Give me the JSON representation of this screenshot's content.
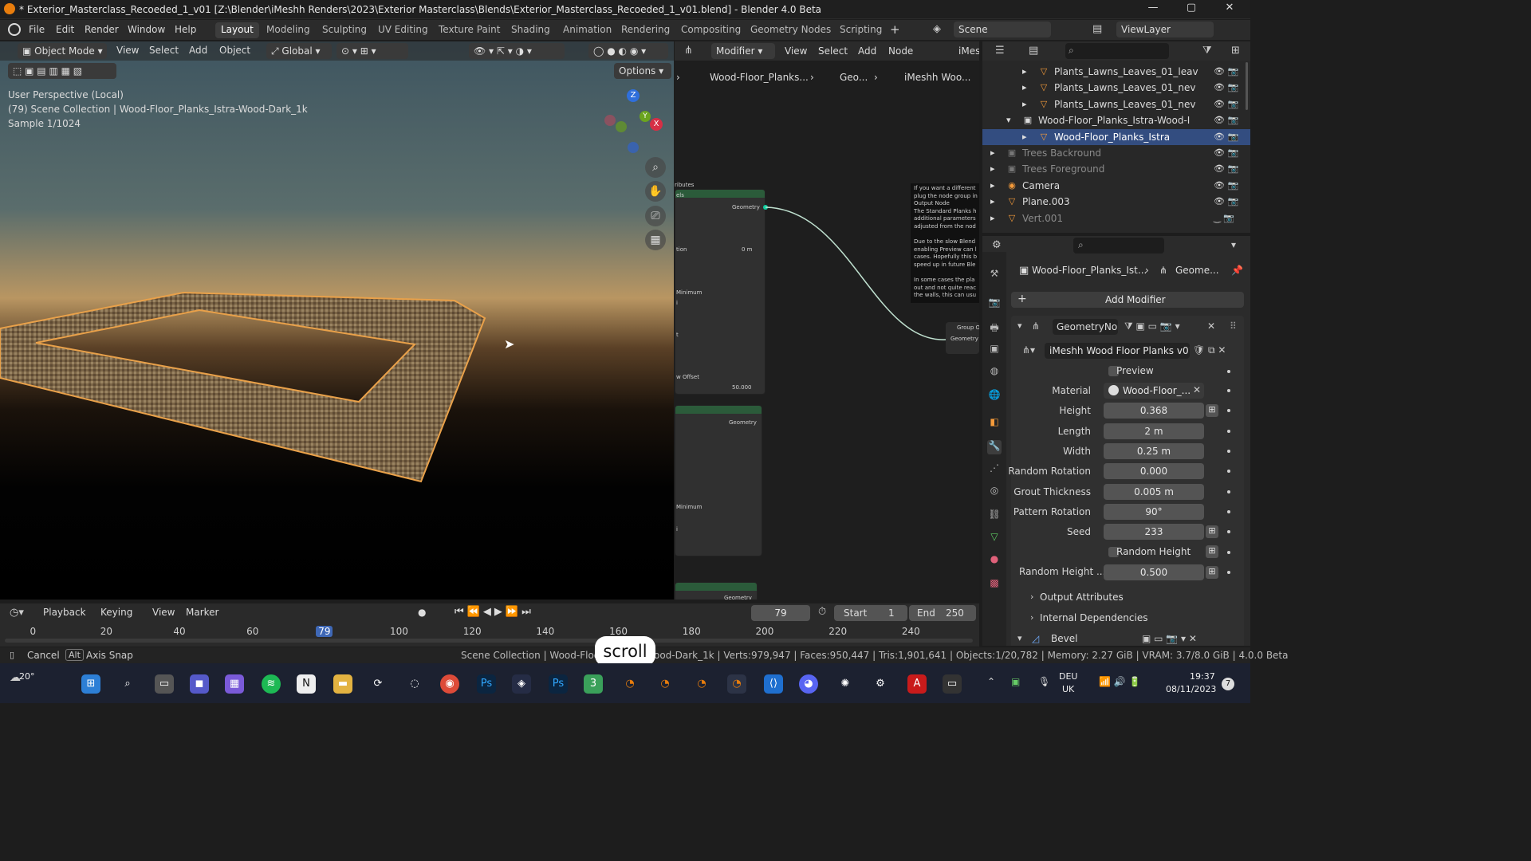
{
  "window": {
    "title": "* Exterior_Masterclass_Recoeded_1_v01 [Z:\\Blender\\iMeshh Renders\\2023\\Exterior Masterclass\\Blends\\Exterior_Masterclass_Recoeded_1_v01.blend] - Blender 4.0 Beta",
    "minimize": "—",
    "maximize": "▢",
    "close": "✕"
  },
  "menubar": {
    "items": [
      "File",
      "Edit",
      "Render",
      "Window",
      "Help"
    ],
    "workspaces": [
      "Layout",
      "Modeling",
      "Sculpting",
      "UV Editing",
      "Texture Paint",
      "Shading",
      "Animation",
      "Rendering",
      "Compositing",
      "Geometry Nodes",
      "Scripting"
    ],
    "active_workspace": "Layout",
    "add_tab": "+",
    "scene": "Scene",
    "view_layer": "ViewLayer"
  },
  "viewport": {
    "mode": "Object Mode",
    "menu": [
      "View",
      "Select",
      "Add",
      "Object"
    ],
    "orientation": "Global",
    "options": "Options",
    "info_line1": "User Perspective (Local)",
    "info_line2": "(79) Scene Collection | Wood-Floor_Planks_Istra-Wood-Dark_1k",
    "info_line3": "Sample 1/1024",
    "gizmo": {
      "z": "Z",
      "y": "Y",
      "x": "X"
    }
  },
  "node_editor": {
    "editor_type": "Modifier",
    "menu": [
      "View",
      "Select",
      "Add",
      "Node"
    ],
    "header_extra": "iMes",
    "breadcrumb": [
      "Wood-Floor_Planks...",
      "Geo...",
      "iMeshh Woo..."
    ],
    "node_frag": {
      "attributes": "ributes",
      "els": "els",
      "geometry": "Geometry",
      "tion": "tion",
      "zero": "0 m",
      "minimum": "Minimum",
      "i": "i",
      "t": "t",
      "w_offset": "w Offset",
      "fifty": "50.000",
      "group_out": "Group O",
      "geometry2": "Geometry"
    },
    "note": [
      "If you want a different",
      "plug the node group in",
      "Output Node",
      "The Standard Planks h",
      "additional parameters",
      "adjusted from the nod",
      "",
      "Due to the slow Blend",
      "enabling Preview can l",
      "cases. Hopefully this b",
      "speed up in future Ble",
      "",
      "In some cases the pla",
      "out and not quite reac",
      "the walls, this can usu"
    ]
  },
  "outliner": {
    "rows": [
      {
        "label": "Plants_Lawns_Leaves_01_leav",
        "dim": false,
        "selected": false
      },
      {
        "label": "Plants_Lawns_Leaves_01_nev",
        "dim": false,
        "selected": false
      },
      {
        "label": "Plants_Lawns_Leaves_01_nev",
        "dim": false,
        "selected": false
      },
      {
        "label": "Wood-Floor_Planks_Istra-Wood-I",
        "dim": false,
        "selected": false
      },
      {
        "label": "Wood-Floor_Planks_Istra",
        "dim": false,
        "selected": true
      },
      {
        "label": "Trees Backround",
        "dim": true,
        "selected": false
      },
      {
        "label": "Trees Foreground",
        "dim": true,
        "selected": false
      },
      {
        "label": "Camera",
        "dim": false,
        "selected": false
      },
      {
        "label": "Plane.003",
        "dim": false,
        "selected": false
      },
      {
        "label": "Vert.001",
        "dim": true,
        "selected": false
      }
    ]
  },
  "properties": {
    "breadcrumb": [
      "Wood-Floor_Planks_Ist...",
      "Geome..."
    ],
    "add_modifier": "Add Modifier",
    "modifier_name": "GeometryNo...",
    "node_group": "iMeshh Wood Floor Planks v01",
    "preview_label": "Preview",
    "fields": [
      {
        "label": "Material",
        "value": "Wood-Floor_..."
      },
      {
        "label": "Height",
        "value": "0.368"
      },
      {
        "label": "Length",
        "value": "2 m"
      },
      {
        "label": "Width",
        "value": "0.25 m"
      },
      {
        "label": "Random Rotation",
        "value": "0.000"
      },
      {
        "label": "Grout Thickness",
        "value": "0.005 m"
      },
      {
        "label": "Pattern Rotation",
        "value": "90°"
      },
      {
        "label": "Seed",
        "value": "233"
      }
    ],
    "random_height_label": "Random Height",
    "random_height_value_label": "Random Height ...",
    "random_height_value": "0.500",
    "output_attributes": "Output Attributes",
    "internal_dependencies": "Internal Dependencies",
    "bevel": "Bevel"
  },
  "timeline": {
    "menu": [
      "Playback",
      "Keying",
      "View",
      "Marker"
    ],
    "current_frame": "79",
    "start_label": "Start",
    "start": "1",
    "end_label": "End",
    "end": "250",
    "ticks": [
      "0",
      "20",
      "40",
      "60",
      "79",
      "100",
      "120",
      "140",
      "160",
      "180",
      "200",
      "220",
      "240"
    ]
  },
  "status": {
    "cancel": "Cancel",
    "alt": "Alt",
    "axis_snap": "Axis Snap",
    "stats_left": "Scene Collection | Wood-Floor",
    "stats_right": "ood-Dark_1k | Verts:979,947 | Faces:950,447 | Tris:1,901,641 | Objects:1/20,782 | Memory: 2.27 GiB | VRAM: 3.7/8.0 GiB | 4.0.0 Beta",
    "scroll_popup": "scroll"
  },
  "taskbar": {
    "weather": "20°",
    "lang1": "DEU",
    "lang2": "UK",
    "time": "19:37",
    "date": "08/11/2023",
    "notif": "7"
  }
}
